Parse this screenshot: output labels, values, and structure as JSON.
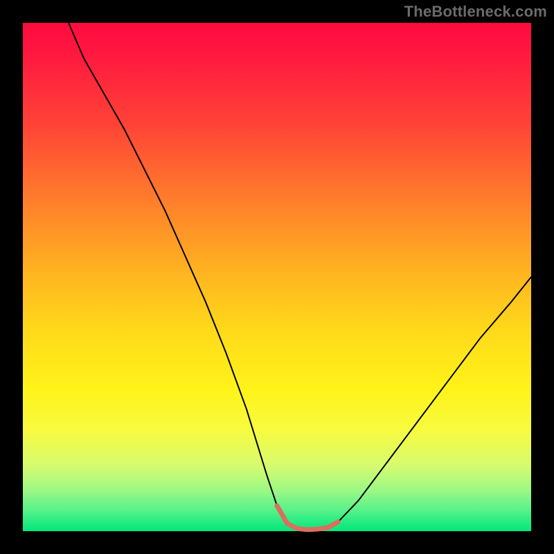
{
  "watermark": "TheBottleneck.com",
  "chart_data": {
    "type": "line",
    "title": "",
    "xlabel": "",
    "ylabel": "",
    "xlim": [
      0,
      100
    ],
    "ylim": [
      0,
      100
    ],
    "grid": false,
    "legend": false,
    "annotations": [],
    "series": [
      {
        "name": "bottleneck-curve",
        "color": "#000000",
        "linewidth": 2,
        "x": [
          9,
          12,
          16,
          20,
          24,
          28,
          32,
          36,
          40,
          44,
          48,
          50,
          52,
          54,
          56,
          58,
          60,
          62,
          66,
          72,
          78,
          84,
          90,
          96,
          100
        ],
        "y": [
          100,
          93,
          86,
          79,
          71,
          63,
          54,
          45,
          35,
          24,
          11,
          5,
          1.5,
          0.5,
          0.3,
          0.4,
          0.7,
          1.8,
          6,
          14,
          22,
          30,
          38,
          45,
          50
        ]
      },
      {
        "name": "optimal-range",
        "color": "#d9705f",
        "linewidth": 7,
        "x": [
          50,
          52,
          54,
          56,
          58,
          60,
          62
        ],
        "y": [
          5,
          1.5,
          0.5,
          0.3,
          0.4,
          0.7,
          1.8
        ]
      }
    ],
    "background_gradient": {
      "orientation": "vertical",
      "stops": [
        {
          "pos": 0.0,
          "color": "#ff0a3f"
        },
        {
          "pos": 0.5,
          "color": "#ffd81a"
        },
        {
          "pos": 0.8,
          "color": "#f8fb3f"
        },
        {
          "pos": 1.0,
          "color": "#00e77c"
        }
      ]
    }
  }
}
